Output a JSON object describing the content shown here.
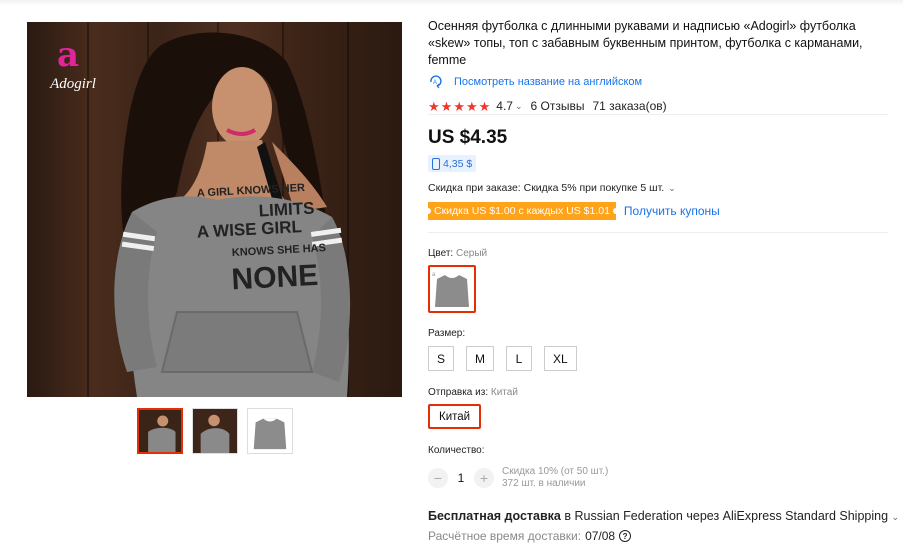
{
  "product": {
    "title": "Осенняя футболка с длинными рукавами и надписью «Adogirl» футболка «skew» топы, топ с забавным буквенным принтом, футболка с карманами, femme",
    "translate_label": "Посмотреть название на английском",
    "rating": {
      "score": "4.7",
      "stars": 5,
      "reviews": "6 Отзывы",
      "orders": "71 заказа(ов)"
    },
    "brand_logo_text": "Adogirl",
    "print_lines": [
      "A GIRL KNOWS HER",
      "LIMITS",
      "A WISE GIRL",
      "KNOWS SHE HAS",
      "NONE"
    ]
  },
  "pricing": {
    "price": "US $4.35",
    "mobile_price": "4,35 $",
    "discount_label": "Скидка при заказе: Скидка 5% при покупке 5 шт.",
    "coupon_tag": "Скидка US $1.00 с каждых US $1.01",
    "coupon_link": "Получить купоны"
  },
  "options": {
    "color_label": "Цвет:",
    "color_value": "Серый",
    "size_label": "Размер:",
    "sizes": [
      "S",
      "M",
      "L",
      "XL"
    ],
    "ship_from_label": "Отправка из:",
    "ship_from_value": "Китай",
    "ship_from_option": "Китай"
  },
  "quantity": {
    "label": "Количество:",
    "value": "1",
    "minus": "−",
    "plus": "+",
    "bulk_discount": "Скидка 10% (от 50 шт.)",
    "stock": "372 шт. в наличии"
  },
  "shipping": {
    "free_label": "Бесплатная доставка",
    "details": "в Russian Federation через AliExpress Standard Shipping",
    "eta_label": "Расчётное время доставки:",
    "eta_date": "07/08"
  },
  "colors": {
    "accent": "#e62e04",
    "star": "#f0352b",
    "link": "#1a73e8",
    "coupon": "#ffa31a"
  }
}
